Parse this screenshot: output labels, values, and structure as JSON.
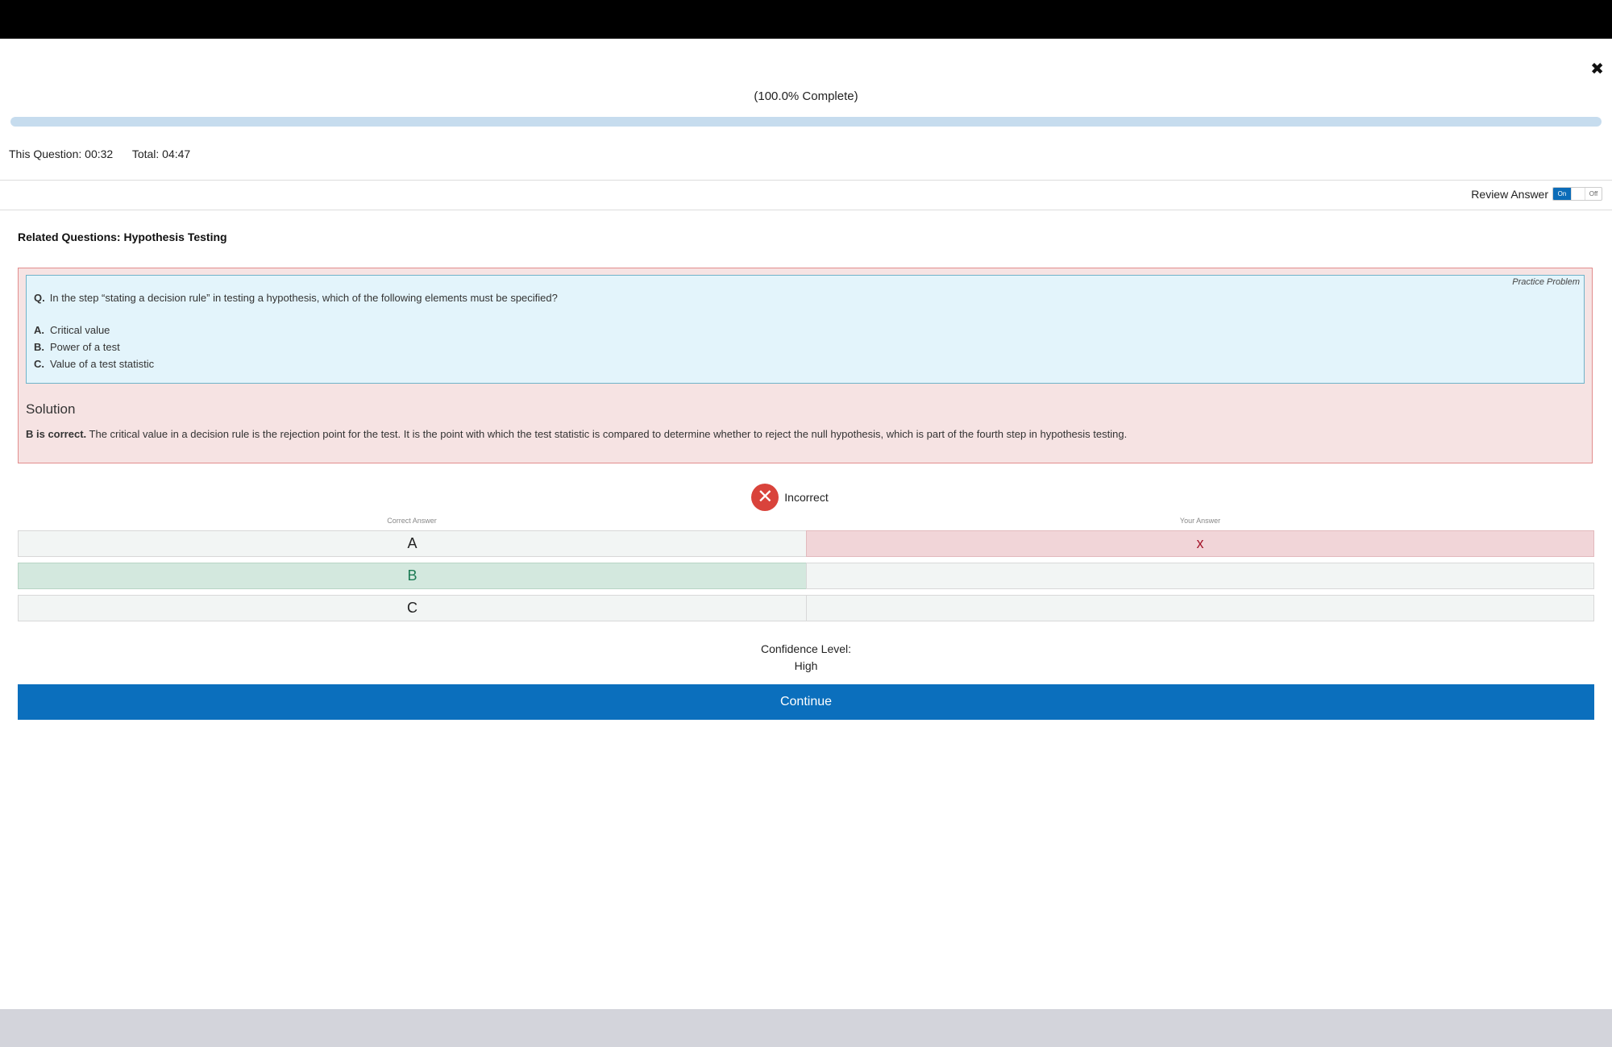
{
  "window": {
    "close_glyph": "✖"
  },
  "progress": {
    "label": "(100.0% Complete)",
    "percent": 100
  },
  "timers": {
    "this_question": "This Question: 00:32",
    "total": "Total: 04:47"
  },
  "review": {
    "label": "Review Answer",
    "toggle_on": "On",
    "toggle_off": "Off"
  },
  "related": {
    "label": "Related Questions: Hypothesis Testing"
  },
  "question": {
    "tag": "Practice Problem",
    "prefix": "Q.",
    "text": "In the step “stating a decision rule” in testing a hypothesis, which of the following elements must be specified?",
    "options": [
      {
        "key": "A.",
        "text": "Critical value"
      },
      {
        "key": "B.",
        "text": "Power of a test"
      },
      {
        "key": "C.",
        "text": "Value of a test statistic"
      }
    ]
  },
  "solution": {
    "title": "Solution",
    "verdict": "B is correct.",
    "text": "The critical value in a decision rule is the rejection point for the test. It is the point with which the test statistic is compared to determine whether to reject the null hypothesis, which is part of the fourth step in hypothesis testing."
  },
  "result": {
    "icon": "✕",
    "label": "Incorrect"
  },
  "answers": {
    "correct_header": "Correct Answer",
    "your_header": "Your Answer",
    "rows": [
      {
        "letter": "A",
        "mark": "x"
      },
      {
        "letter": "B",
        "mark": ""
      },
      {
        "letter": "C",
        "mark": ""
      }
    ]
  },
  "confidence": {
    "label": "Confidence Level:",
    "value": "High"
  },
  "continue_label": "Continue",
  "colors": {
    "accent": "#0b6fbd",
    "incorrect": "#d9433b",
    "correct_bg": "#d3e8de",
    "wrong_bg": "#f1d5d8"
  }
}
